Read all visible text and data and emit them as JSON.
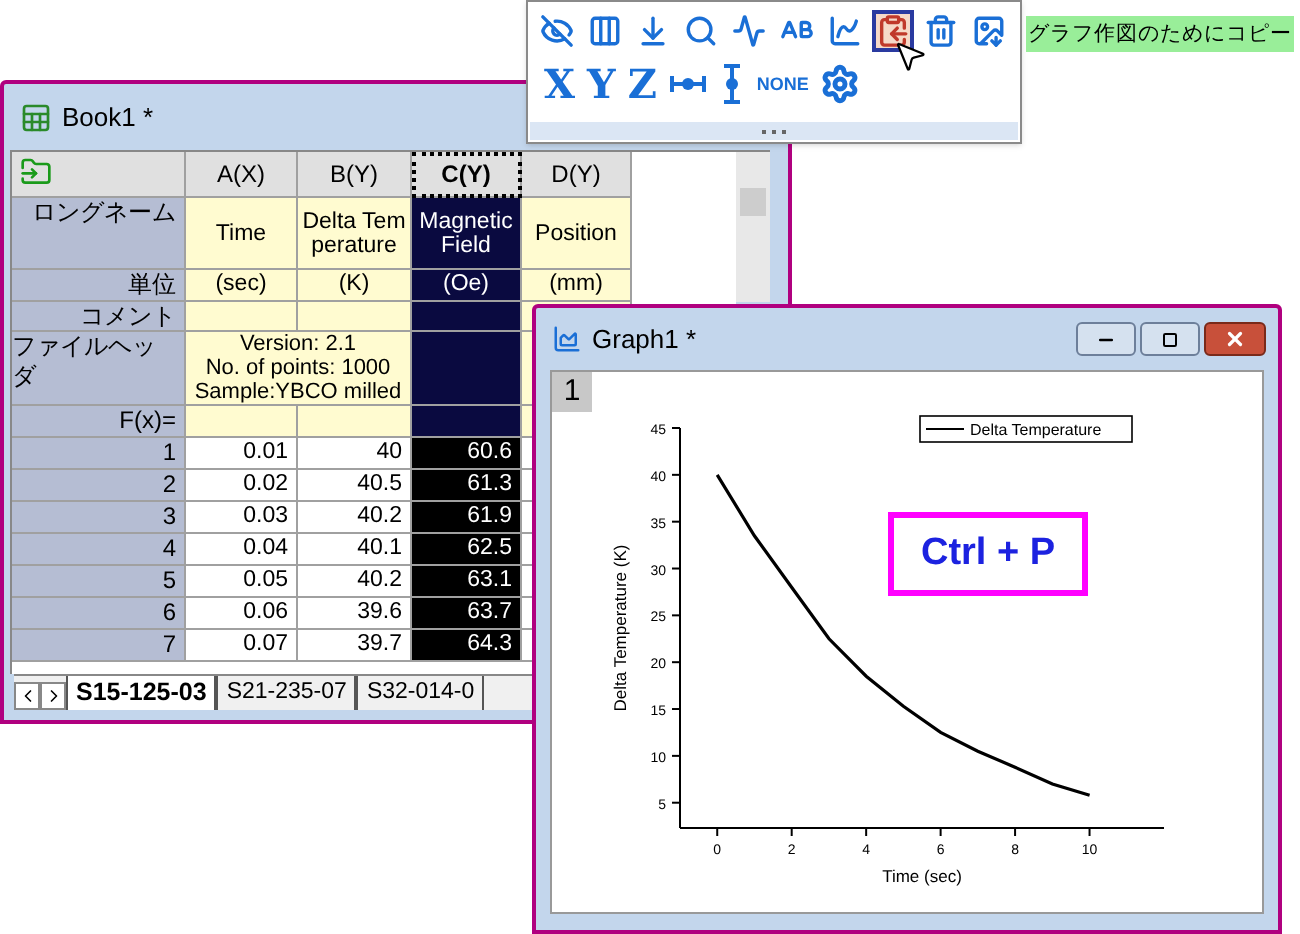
{
  "toolbar_popup": {
    "row_1": [
      {
        "selected": false
      },
      {
        "selected": false
      },
      {
        "selected": false
      },
      {
        "selected": false
      },
      {
        "selected": false
      },
      {
        "selected": false
      },
      {
        "selected": false
      },
      {
        "selected": true
      },
      {
        "selected": false
      },
      {
        "selected": false
      }
    ],
    "row_2": [
      {
        "kind": "text",
        "label": "X"
      },
      {
        "kind": "text",
        "label": "Y"
      },
      {
        "kind": "text",
        "label": "Z"
      },
      {
        "kind": "icon"
      },
      {
        "kind": "icon"
      },
      {
        "kind": "small_text",
        "label": "NONE"
      },
      {
        "kind": "icon"
      }
    ],
    "tooltip": "グラフ作図のためにコピー"
  },
  "book": {
    "title": "Book1 *",
    "row_labels": {
      "long_name": "ロングネーム",
      "units": "単位",
      "comment": "コメント",
      "file_header": "ファイルヘッダ",
      "formula": "F(x)="
    },
    "columns": [
      {
        "label": "A(X)",
        "selected": false,
        "long_name": "Time",
        "units": "(sec)"
      },
      {
        "label": "B(Y)",
        "selected": false,
        "long_name": "Delta Temperature",
        "units": "(K)"
      },
      {
        "label": "C(Y)",
        "selected": true,
        "long_name": "Magnetic Field",
        "units": "(Oe)"
      },
      {
        "label": "D(Y)",
        "selected": false,
        "long_name": "Position",
        "units": "(mm)"
      }
    ],
    "file_header": [
      "Version: 2.1",
      "No. of points: 1000",
      "Sample:YBCO milled"
    ],
    "rows": [
      {
        "index": "1",
        "values": [
          "0.01",
          "40",
          "60.6"
        ]
      },
      {
        "index": "2",
        "values": [
          "0.02",
          "40.5",
          "61.3"
        ]
      },
      {
        "index": "3",
        "values": [
          "0.03",
          "40.2",
          "61.9"
        ]
      },
      {
        "index": "4",
        "values": [
          "0.04",
          "40.1",
          "62.5"
        ]
      },
      {
        "index": "5",
        "values": [
          "0.05",
          "40.2",
          "63.1"
        ]
      },
      {
        "index": "6",
        "values": [
          "0.06",
          "39.6",
          "63.7"
        ]
      },
      {
        "index": "7",
        "values": [
          "0.07",
          "39.7",
          "64.3"
        ]
      }
    ],
    "sheet_tabs": [
      {
        "label": "S15-125-03",
        "selected": true
      },
      {
        "label": "S21-235-07",
        "selected": false
      },
      {
        "label": "S32-014-0",
        "selected": false
      }
    ]
  },
  "graph": {
    "title": "Graph1 *",
    "layer": "1",
    "callout": "Ctrl + P",
    "chart_data": {
      "type": "line",
      "xlabel": "Time (sec)",
      "ylabel": "Delta Temperature (K)",
      "x": [
        0,
        1,
        2,
        3,
        4,
        5,
        6,
        7,
        8,
        9,
        10
      ],
      "series": [
        {
          "name": "Delta Temperature",
          "color": "#000000",
          "values": [
            40,
            33.5,
            28,
            22.5,
            18.5,
            15.3,
            12.5,
            10.5,
            8.8,
            7,
            5.8
          ]
        }
      ],
      "xlim": [
        -1,
        12
      ],
      "ylim": [
        2.3,
        45
      ],
      "xticks": [
        0,
        2,
        4,
        6,
        8,
        10
      ],
      "yticks": [
        5,
        10,
        15,
        20,
        25,
        30,
        35,
        40,
        45
      ]
    }
  }
}
